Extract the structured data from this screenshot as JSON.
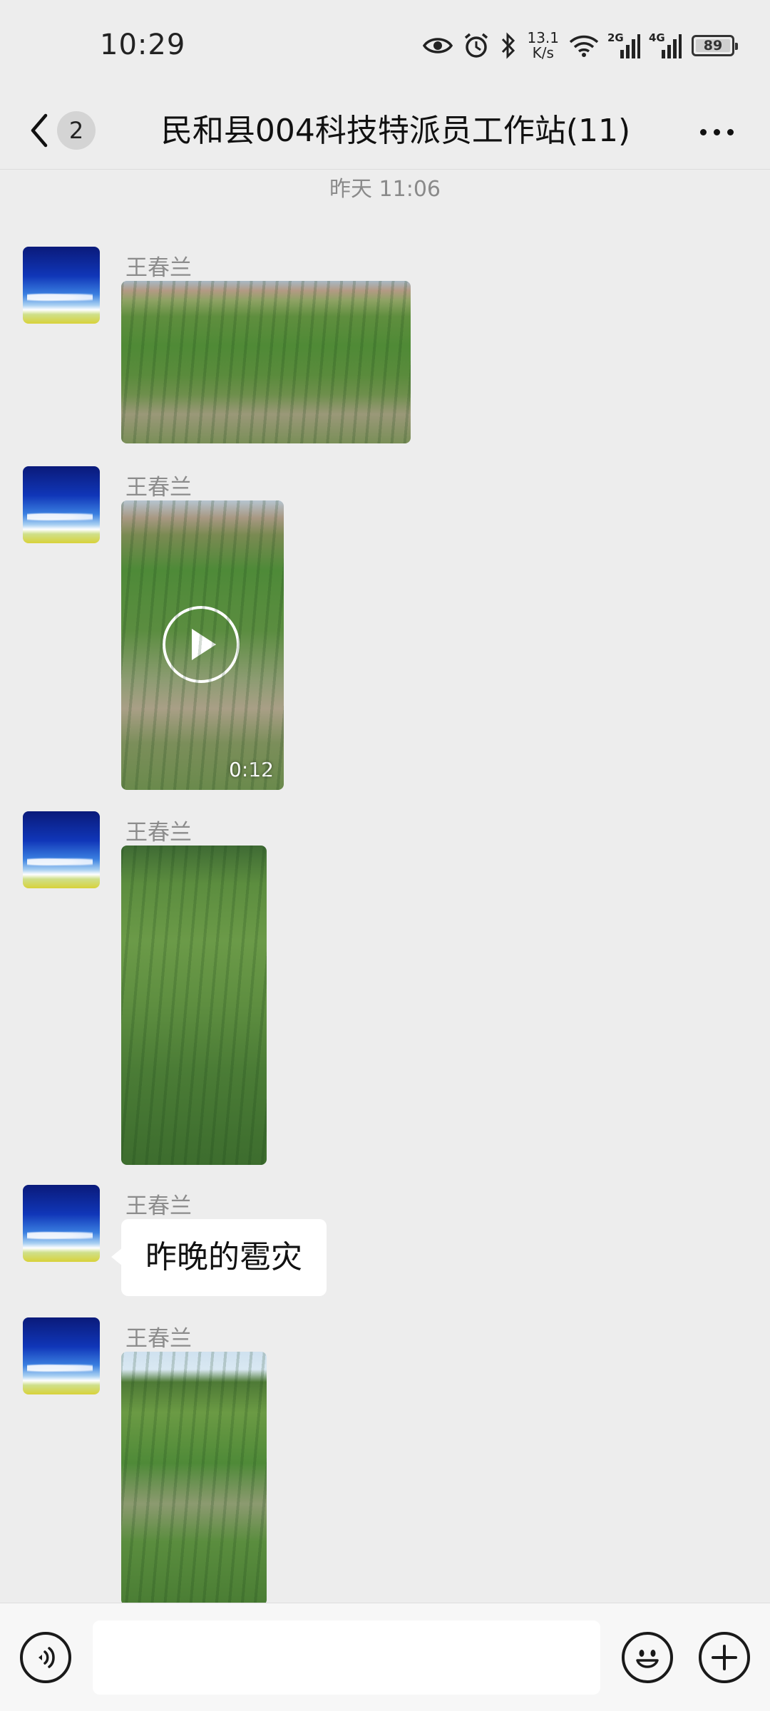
{
  "status_bar": {
    "time": "10:29",
    "speed_value": "13.1",
    "speed_unit": "K/s",
    "sim1_tag": "2G",
    "sim2_tag": "4G",
    "battery": "89"
  },
  "header": {
    "back_count": "2",
    "title": "民和县004科技特派员工作站(11)"
  },
  "chat": {
    "timestamp": "昨天 11:06",
    "messages": [
      {
        "sender": "王春兰",
        "type": "image",
        "icons": "photo-field"
      },
      {
        "sender": "王春兰",
        "type": "video",
        "duration": "0:12"
      },
      {
        "sender": "王春兰",
        "type": "image",
        "icons": "photo-rapeseed"
      },
      {
        "sender": "王春兰",
        "type": "text",
        "text": "昨晚的雹灾"
      },
      {
        "sender": "王春兰",
        "type": "image",
        "icons": "photo-corn"
      }
    ]
  },
  "input_bar": {
    "placeholder": "",
    "icons": [
      "voice-icon",
      "emoji-icon",
      "plus-icon"
    ]
  },
  "colors": {
    "background": "#ededed",
    "bubble": "#ffffff",
    "sender_text": "#8c8c8c"
  }
}
